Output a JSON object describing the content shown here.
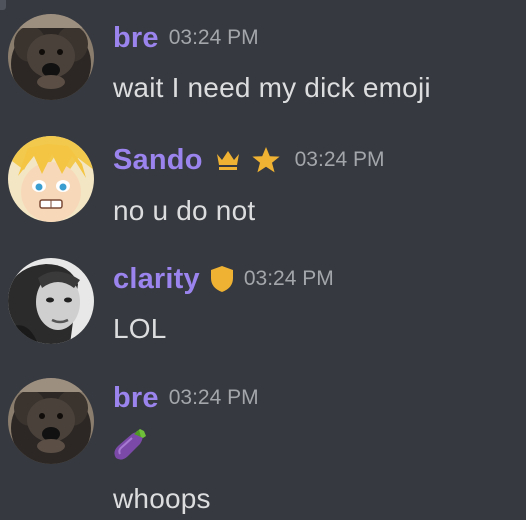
{
  "messages": [
    {
      "username": "bre",
      "timestamp": "03:24 PM",
      "lines": [
        "wait I need my dick emoji"
      ],
      "avatar_icon": "dog-avatar-icon",
      "username_color": "#9b84ee"
    },
    {
      "username": "Sando",
      "timestamp": "03:24 PM",
      "lines": [
        "no u do not"
      ],
      "badges": [
        "crown-icon",
        "star-icon"
      ],
      "avatar_icon": "anime-boy-avatar-icon",
      "username_color": "#9b84ee"
    },
    {
      "username": "clarity",
      "timestamp": "03:24 PM",
      "lines": [
        "LOL"
      ],
      "badges": [
        "shield-icon"
      ],
      "avatar_icon": "woman-portrait-avatar-icon",
      "username_color": "#9b84ee"
    },
    {
      "username": "bre",
      "timestamp": "03:24 PM",
      "emoji": "eggplant-emoji",
      "lines": [
        "whoops"
      ],
      "avatar_icon": "dog-avatar-icon",
      "username_color": "#9b84ee"
    }
  ],
  "colors": {
    "background": "#36393f",
    "username": "#9b84ee",
    "timestamp": "#a3a6aa",
    "message_text": "#dcddde",
    "badge_gold": "#f0b232"
  }
}
